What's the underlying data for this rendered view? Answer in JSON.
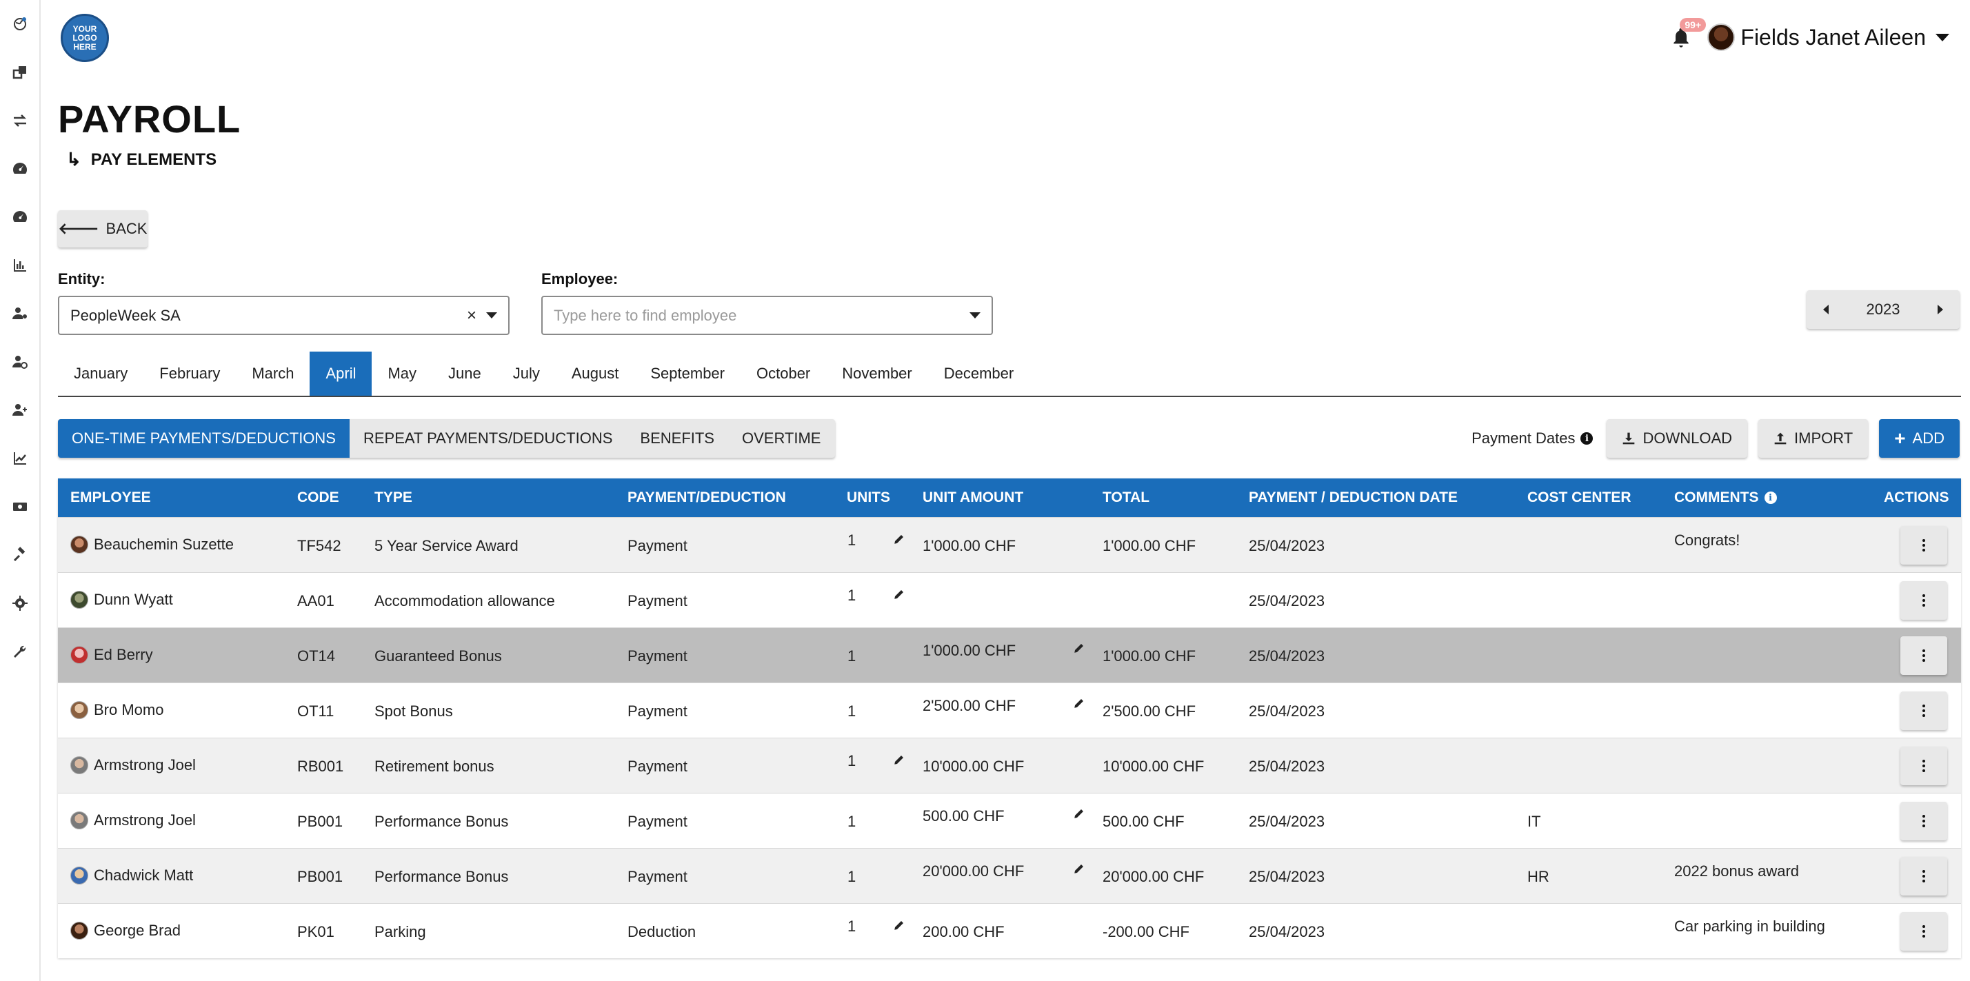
{
  "header": {
    "logo_text": [
      "YOUR",
      "LOGO",
      "HERE"
    ],
    "notification_count": "99+",
    "user_name": "Fields Janet Aileen"
  },
  "page": {
    "title": "PAYROLL",
    "subtitle": "PAY ELEMENTS",
    "back_label": "BACK"
  },
  "filters": {
    "entity_label": "Entity:",
    "entity_value": "PeopleWeek SA",
    "employee_label": "Employee:",
    "employee_placeholder": "Type here to find employee",
    "year": "2023"
  },
  "months": [
    "January",
    "February",
    "March",
    "April",
    "May",
    "June",
    "July",
    "August",
    "September",
    "October",
    "November",
    "December"
  ],
  "active_month": "April",
  "tabs": [
    "ONE-TIME PAYMENTS/DEDUCTIONS",
    "REPEAT PAYMENTS/DEDUCTIONS",
    "BENEFITS",
    "OVERTIME"
  ],
  "active_tab": "ONE-TIME PAYMENTS/DEDUCTIONS",
  "actions": {
    "payment_dates_label": "Payment Dates",
    "download_label": "DOWNLOAD",
    "import_label": "IMPORT",
    "add_label": "ADD"
  },
  "table": {
    "columns": [
      "EMPLOYEE",
      "CODE",
      "TYPE",
      "PAYMENT/DEDUCTION",
      "UNITS",
      "UNIT AMOUNT",
      "TOTAL",
      "PAYMENT / DEDUCTION DATE",
      "COST CENTER",
      "COMMENTS",
      "ACTIONS"
    ],
    "rows": [
      {
        "employee": "Beauchemin Suzette",
        "code": "TF542",
        "type": "5 Year Service Award",
        "kind": "Payment",
        "units": "1",
        "unit_amount": "1'000.00 CHF",
        "total": "1'000.00 CHF",
        "date": "25/04/2023",
        "cost_center": "",
        "comments": "Congrats!"
      },
      {
        "employee": "Dunn Wyatt",
        "code": "AA01",
        "type": "Accommodation allowance",
        "kind": "Payment",
        "units": "1",
        "unit_amount": "",
        "total": "",
        "date": "25/04/2023",
        "cost_center": "",
        "comments": ""
      },
      {
        "employee": "Ed Berry",
        "code": "OT14",
        "type": "Guaranteed Bonus",
        "kind": "Payment",
        "units": "1",
        "unit_amount": "1'000.00 CHF",
        "total": "1'000.00 CHF",
        "date": "25/04/2023",
        "cost_center": "",
        "comments": ""
      },
      {
        "employee": "Bro Momo",
        "code": "OT11",
        "type": "Spot Bonus",
        "kind": "Payment",
        "units": "1",
        "unit_amount": "2'500.00 CHF",
        "total": "2'500.00 CHF",
        "date": "25/04/2023",
        "cost_center": "",
        "comments": ""
      },
      {
        "employee": "Armstrong Joel",
        "code": "RB001",
        "type": "Retirement bonus",
        "kind": "Payment",
        "units": "1",
        "unit_amount": "10'000.00 CHF",
        "total": "10'000.00 CHF",
        "date": "25/04/2023",
        "cost_center": "",
        "comments": ""
      },
      {
        "employee": "Armstrong Joel",
        "code": "PB001",
        "type": "Performance Bonus",
        "kind": "Payment",
        "units": "1",
        "unit_amount": "500.00 CHF",
        "total": "500.00 CHF",
        "date": "25/04/2023",
        "cost_center": "IT",
        "comments": ""
      },
      {
        "employee": "Chadwick Matt",
        "code": "PB001",
        "type": "Performance Bonus",
        "kind": "Payment",
        "units": "1",
        "unit_amount": "20'000.00 CHF",
        "total": "20'000.00 CHF",
        "date": "25/04/2023",
        "cost_center": "HR",
        "comments": "2022 bonus award"
      },
      {
        "employee": "George Brad",
        "code": "PK01",
        "type": "Parking",
        "kind": "Deduction",
        "units": "1",
        "unit_amount": "200.00 CHF",
        "total": "-200.00 CHF",
        "date": "25/04/2023",
        "cost_center": "",
        "comments": "Car parking in building"
      }
    ]
  },
  "sidebar": {
    "icons": [
      "globe-icon",
      "copy-icon",
      "transfer-icon",
      "dashboard-icon",
      "dashboard-alt-icon",
      "bar-chart-icon",
      "user-cog-icon",
      "user-clock-icon",
      "user-plus-icon",
      "line-chart-icon",
      "money-icon",
      "gavel-icon",
      "gear-icon",
      "wrench-icon"
    ]
  },
  "colors": {
    "primary": "#1a6dba",
    "button_grey": "#e8e8e8",
    "row_highlight": "#bdbdbd",
    "badge": "#f29a9a"
  }
}
